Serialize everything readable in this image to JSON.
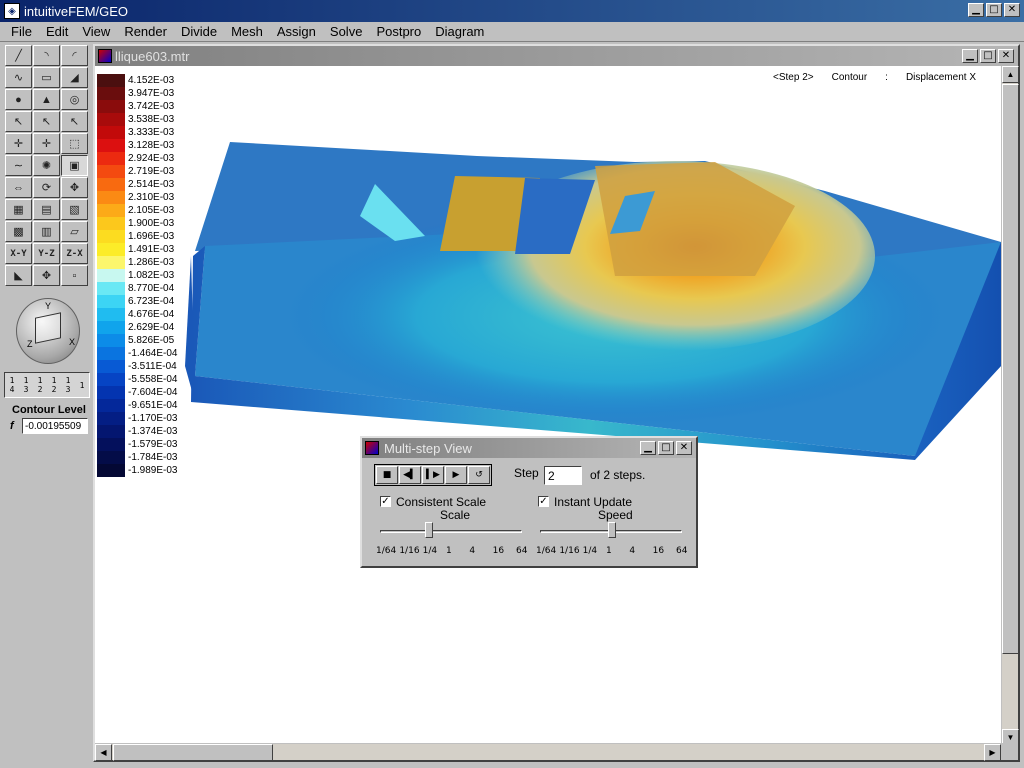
{
  "app": {
    "title": "intuitiveFEM/GEO"
  },
  "menu": [
    "File",
    "Edit",
    "View",
    "Render",
    "Divide",
    "Mesh",
    "Assign",
    "Solve",
    "Postpro",
    "Diagram"
  ],
  "toolbox": {
    "text_tools": [
      "X-Y",
      "Y-Z",
      "Z-X"
    ],
    "level_fracs": [
      [
        "1",
        "4"
      ],
      [
        "1",
        "3"
      ],
      [
        "1",
        "2"
      ],
      [
        "1",
        "2"
      ],
      [
        "1",
        "3"
      ],
      [
        "1"
      ]
    ],
    "axis_labels": {
      "y": "Y",
      "x": "X",
      "z": "Z"
    },
    "contour_label": "Contour Level",
    "f_label": "f",
    "f_value": "-0.00195509"
  },
  "child": {
    "title": "llique603.mtr",
    "step_tag": "<Step 2>",
    "mode": "Contour",
    "sep": ":",
    "quantity": "Displacement X"
  },
  "legend": [
    {
      "label": "4.152E-03",
      "color": "#4b0f0f"
    },
    {
      "label": "3.947E-03",
      "color": "#6a0d0d"
    },
    {
      "label": "3.742E-03",
      "color": "#8a0c0c"
    },
    {
      "label": "3.538E-03",
      "color": "#a80b0b"
    },
    {
      "label": "3.333E-03",
      "color": "#c20a0a"
    },
    {
      "label": "3.128E-03",
      "color": "#dc1010"
    },
    {
      "label": "2.924E-03",
      "color": "#ec2a10"
    },
    {
      "label": "2.719E-03",
      "color": "#f44a10"
    },
    {
      "label": "2.514E-03",
      "color": "#f86a10"
    },
    {
      "label": "2.310E-03",
      "color": "#fb8a14"
    },
    {
      "label": "2.105E-03",
      "color": "#fcaa18"
    },
    {
      "label": "1.900E-03",
      "color": "#fcc81c"
    },
    {
      "label": "1.696E-03",
      "color": "#fcdc20"
    },
    {
      "label": "1.491E-03",
      "color": "#fcec28"
    },
    {
      "label": "1.286E-03",
      "color": "#fcf66c"
    },
    {
      "label": "1.082E-03",
      "color": "#c8f8f0"
    },
    {
      "label": "8.770E-04",
      "color": "#6ae8f4"
    },
    {
      "label": "6.723E-04",
      "color": "#3cd4f4"
    },
    {
      "label": "4.676E-04",
      "color": "#20bcf0"
    },
    {
      "label": "2.629E-04",
      "color": "#10a4ec"
    },
    {
      "label": "5.826E-05",
      "color": "#0c8ce8"
    },
    {
      "label": "-1.464E-04",
      "color": "#0a74e0"
    },
    {
      "label": "-3.511E-04",
      "color": "#085ad4"
    },
    {
      "label": "-5.558E-04",
      "color": "#0644c4"
    },
    {
      "label": "-7.604E-04",
      "color": "#0434b0"
    },
    {
      "label": "-9.651E-04",
      "color": "#04289a"
    },
    {
      "label": "-1.170E-03",
      "color": "#041e84"
    },
    {
      "label": "-1.374E-03",
      "color": "#041670"
    },
    {
      "label": "-1.579E-03",
      "color": "#04105c"
    },
    {
      "label": "-1.784E-03",
      "color": "#040c48"
    },
    {
      "label": "-1.989E-03",
      "color": "#040834"
    }
  ],
  "dialog": {
    "title": "Multi-step View",
    "step_label": "Step",
    "step_value": "2",
    "of_steps": "of 2 steps.",
    "consistent_scale_label": "Consistent Scale",
    "instant_update_label": "Instant Update",
    "scale_label": "Scale",
    "speed_label": "Speed",
    "ticks": [
      "1/64",
      "1/16",
      "1/4",
      "1",
      "4",
      "16",
      "64"
    ],
    "scale_index": 2,
    "speed_index": 3,
    "consistent_scale_checked": true,
    "instant_update_checked": true
  }
}
